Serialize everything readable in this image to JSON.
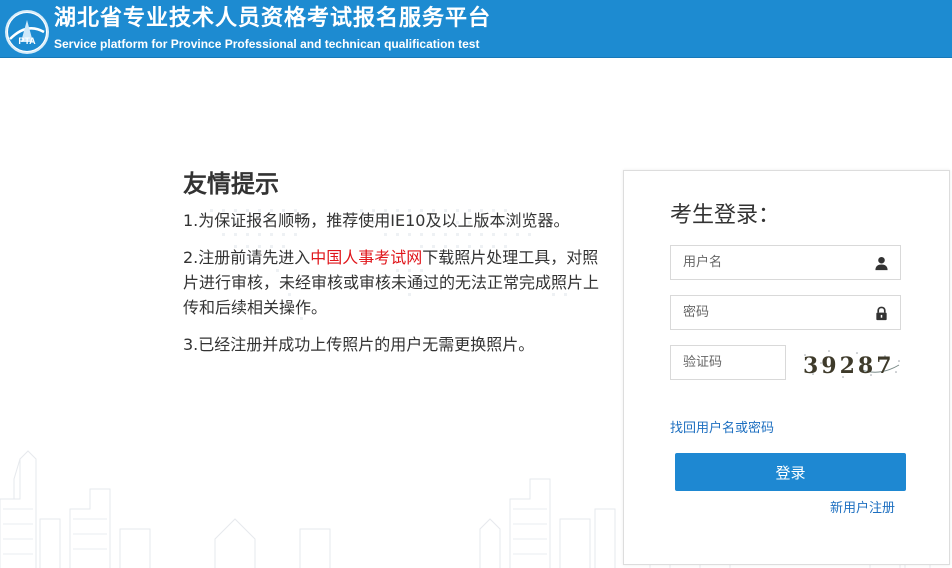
{
  "header": {
    "title": "湖北省专业技术人员资格考试报名服务平台",
    "subtitle": "Service platform for Province Professional and technican qualification test",
    "logo_text": "PTA",
    "background_color": "#1d8bd1"
  },
  "tips": {
    "title": "友情提示",
    "item1": "1.为保证报名顺畅，推荐使用IE10及以上版本浏览器。",
    "item2_before": "2.注册前请先进入",
    "item2_link": "中国人事考试网",
    "item2_after": "下载照片处理工具，对照片进行审核，未经审核或审核未通过的无法正常完成照片上传和后续相关操作。",
    "item3": "3.已经注册并成功上传照片的用户无需更换照片。",
    "link_color": "#e0161b"
  },
  "login": {
    "title": "考生登录：",
    "username_placeholder": "用户名",
    "password_placeholder": "密码",
    "captcha_placeholder": "验证码",
    "captcha_text": "39287",
    "forgot_link": "找回用户名或密码",
    "submit_label": "登录",
    "register_link": "新用户注册",
    "button_color": "#1e88d2",
    "link_color": "#1d6fc0"
  },
  "icons": {
    "username": "user-icon",
    "password": "lock-icon",
    "logo": "pta-logo"
  }
}
